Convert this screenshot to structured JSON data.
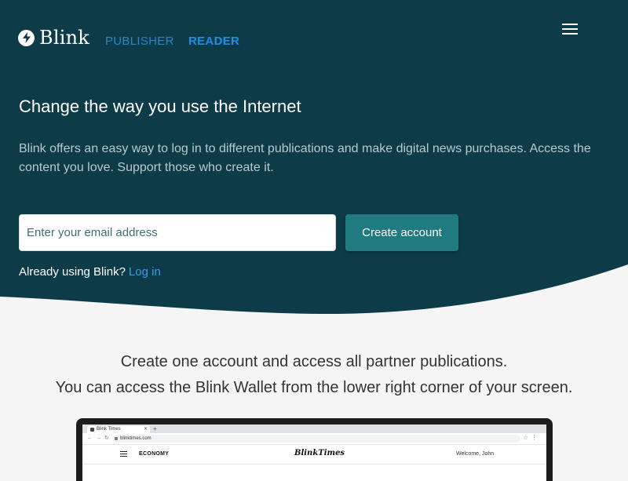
{
  "colors": {
    "hero_bg": "#0d3b48",
    "page_bg": "#f4f5f4",
    "accent_button": "#1f7b80",
    "link_blue": "#3a9be8",
    "nav_publisher": "#2b86c5",
    "nav_reader": "#1e90e6"
  },
  "header": {
    "logo_icon": "lightning-bolt-icon",
    "logo_text": "Blink",
    "nav": {
      "publisher": "PUBLISHER",
      "reader": "READER"
    },
    "menu_icon": "hamburger-menu-icon"
  },
  "hero": {
    "title": "Change the way you use the Internet",
    "description": "Blink offers an easy way to log in to different publications and make digital news purchases. Access the content you love. Support those who create it.",
    "email_placeholder": "Enter your email address",
    "email_value": "",
    "create_button": "Create account",
    "login_prompt": "Already using Blink?",
    "login_link": "Log in"
  },
  "features": {
    "line1": "Create one account and access all partner publications.",
    "line2": "You can access the Blink Wallet from the lower right corner of your screen."
  },
  "mockup": {
    "tab_title": "Blink Times",
    "new_tab": "+",
    "url": "blinktimes.com",
    "section": "ECONOMY",
    "brand": "BlinkTimes",
    "greeting": "Welcome, John"
  }
}
